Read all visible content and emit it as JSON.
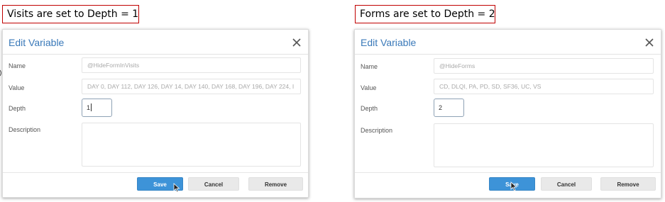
{
  "left": {
    "caption": "Visits are set to Depth = 1",
    "dialog": {
      "title": "Edit Variable",
      "name_label": "Name",
      "name_value": "@HideFormInVisits",
      "value_label": "Value",
      "value_value": "DAY 0, DAY 112, DAY 126, DAY 14, DAY 140, DAY 168, DAY 196, DAY 224, I",
      "depth_label": "Depth",
      "depth_value": "1",
      "description_label": "Description",
      "description_value": "",
      "save_label": "Save",
      "cancel_label": "Cancel",
      "remove_label": "Remove"
    }
  },
  "right": {
    "caption": "Forms are set to Depth = 2",
    "dialog": {
      "title": "Edit Variable",
      "name_label": "Name",
      "name_value": "@HideForms",
      "value_label": "Value",
      "value_value": "CD, DLQI, PA, PD, SD, SF36, UC, VS",
      "depth_label": "Depth",
      "depth_value": "2",
      "description_label": "Description",
      "description_value": "",
      "save_label": "Save",
      "cancel_label": "Cancel",
      "remove_label": "Remove"
    }
  },
  "icons": {
    "close": "close-icon",
    "pointer": "mouse-pointer-icon"
  },
  "colors": {
    "caption_border": "#c00000",
    "title": "#3a79b9",
    "save_button": "#3d93d8",
    "secondary_button": "#e9e9e9"
  }
}
